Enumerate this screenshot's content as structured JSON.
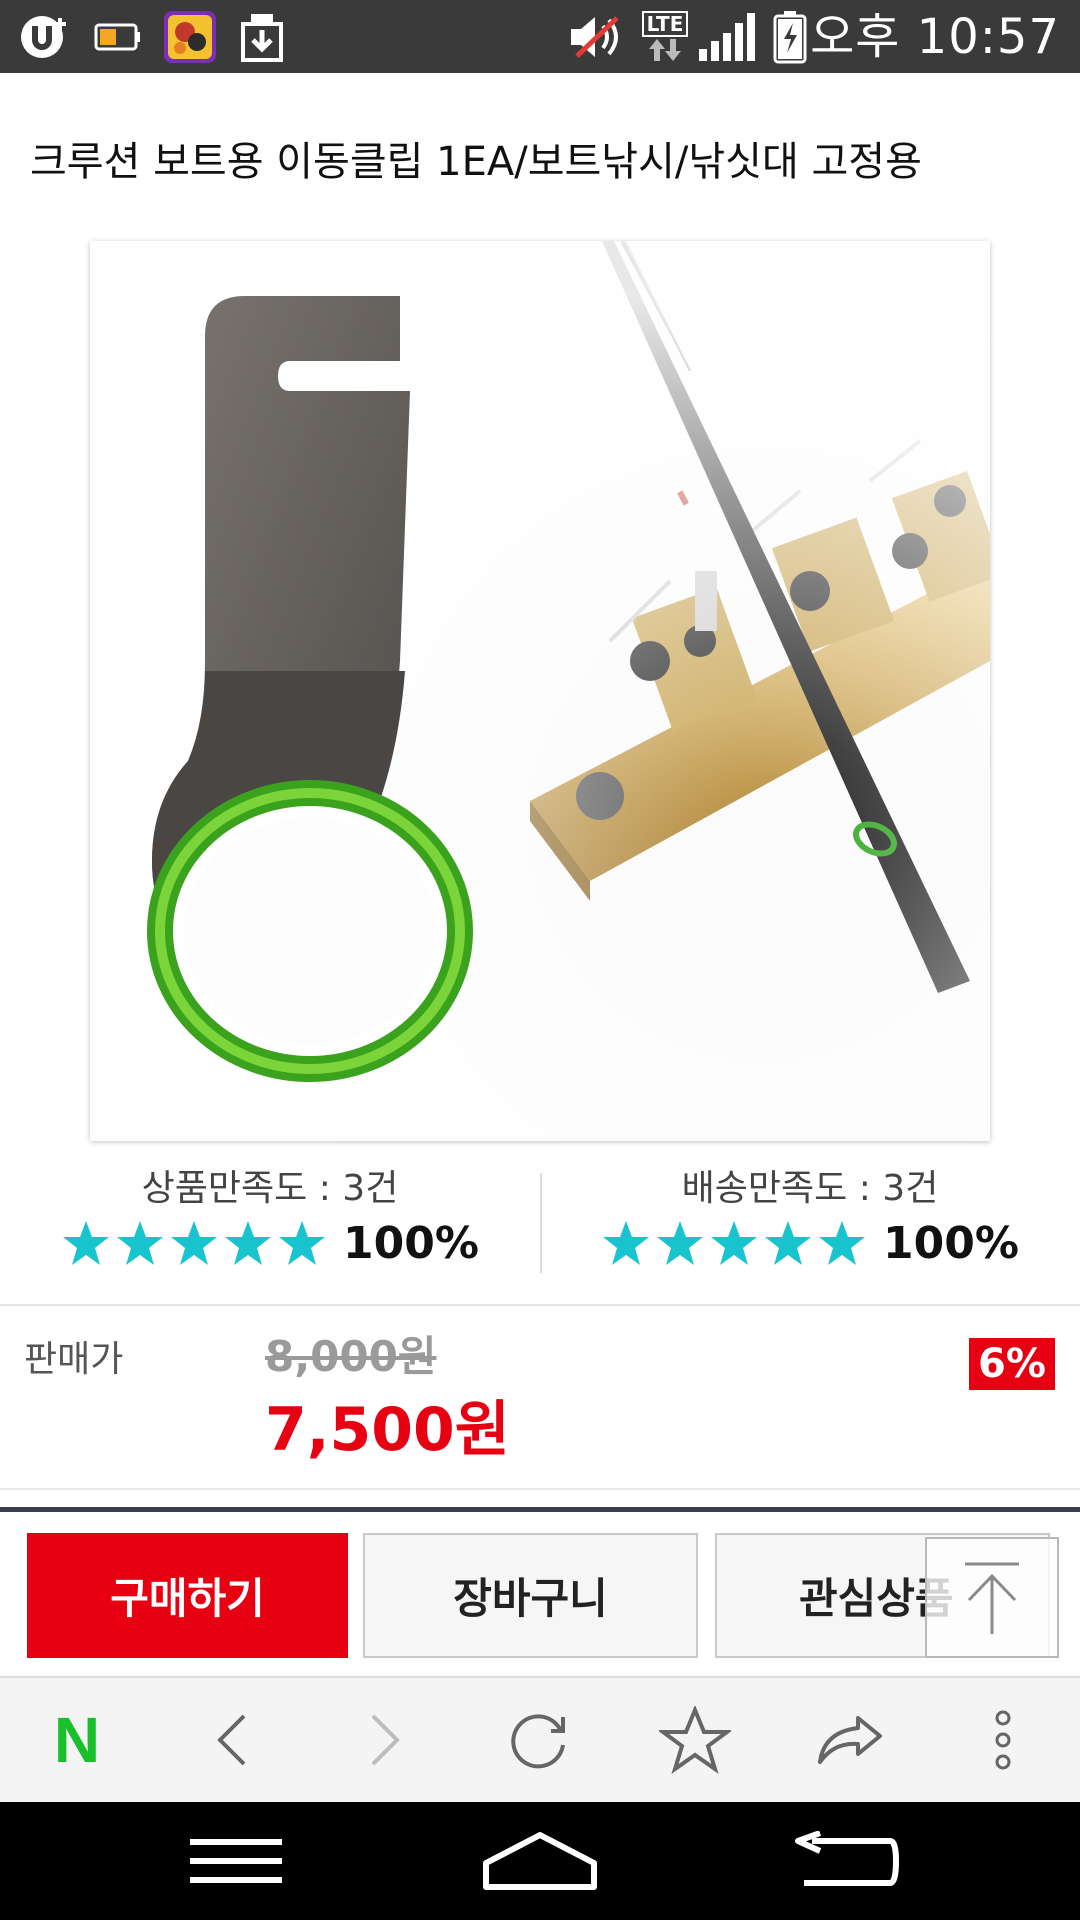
{
  "status_bar": {
    "time": "오후 10:57",
    "network_label": "LTE",
    "icons": [
      "carrier-u-plus-icon",
      "battery-saver-icon",
      "game-app-icon",
      "download-icon",
      "mute-icon",
      "lte-data-icon",
      "signal-icon",
      "battery-charging-icon"
    ]
  },
  "product": {
    "title": "크루션 보트용 이동클립 1EA/보트낚시/낚싯대 고정용"
  },
  "ratings": {
    "product": {
      "label": "상품만족도 : 3건",
      "percent": "100%",
      "stars": 5
    },
    "delivery": {
      "label": "배송만족도 : 3건",
      "percent": "100%",
      "stars": 5
    },
    "star_color": "#18c5cf"
  },
  "price": {
    "label": "판매가",
    "original": "8,000원",
    "sale": "7,500원",
    "discount": "6%",
    "sale_color": "#e60012"
  },
  "actions": {
    "buy": "구매하기",
    "cart": "장바구니",
    "wishlist": "관심상품"
  },
  "browser_toolbar": {
    "icons": [
      "naver-n-icon",
      "back-arrow-icon",
      "forward-arrow-icon",
      "refresh-icon",
      "bookmark-star-icon",
      "share-icon",
      "more-menu-icon"
    ],
    "brand_letter": "N",
    "brand_color": "#19c02b"
  },
  "navigation_bar": {
    "icons": [
      "menu-icon",
      "home-icon",
      "back-icon"
    ]
  }
}
